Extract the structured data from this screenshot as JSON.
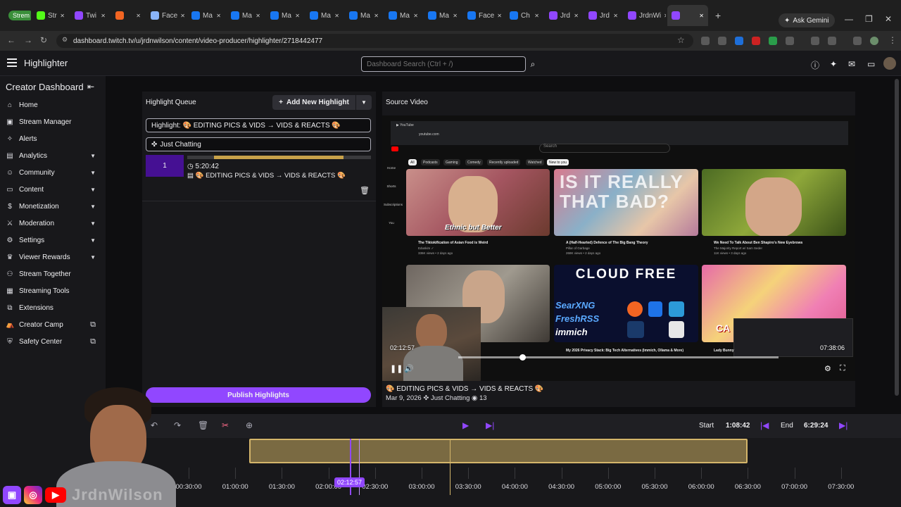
{
  "browser": {
    "tabs": [
      {
        "label": "Strem",
        "color": "#3a8f3a",
        "pill": true
      },
      {
        "label": "Str",
        "color": "#53fc18"
      },
      {
        "label": "Twi",
        "color": "#9147ff"
      },
      {
        "label": "",
        "color": "#f26522"
      },
      {
        "label": "Face",
        "color": "#8ab4f8"
      },
      {
        "label": "Ma",
        "color": "#1877f2"
      },
      {
        "label": "Ma",
        "color": "#1877f2"
      },
      {
        "label": "Ma",
        "color": "#1877f2"
      },
      {
        "label": "Ma",
        "color": "#1877f2"
      },
      {
        "label": "Ma",
        "color": "#1877f2"
      },
      {
        "label": "Ma",
        "color": "#1877f2"
      },
      {
        "label": "Ma",
        "color": "#1877f2"
      },
      {
        "label": "Face",
        "color": "#1877f2"
      },
      {
        "label": "Ch",
        "color": "#1877f2"
      },
      {
        "label": "Jrd",
        "color": "#9147ff"
      },
      {
        "label": "Jrd",
        "color": "#9147ff"
      },
      {
        "label": "JrdnWi",
        "color": "#9147ff"
      },
      {
        "label": "",
        "color": "#9147ff",
        "active": true
      }
    ],
    "ask_gemini": "Ask Gemini",
    "url": "dashboard.twitch.tv/u/jrdnwilson/content/video-producer/highlighter/2718442477"
  },
  "header": {
    "title": "Highlighter",
    "search_placeholder": "Dashboard Search (Ctrl + /)"
  },
  "sidebar": {
    "title": "Creator Dashboard",
    "items": [
      {
        "label": "Home",
        "icon": "home-icon",
        "glyph": "⌂",
        "chevron": false,
        "external": false
      },
      {
        "label": "Stream Manager",
        "icon": "stream-manager-icon",
        "glyph": "▣",
        "chevron": false,
        "external": false
      },
      {
        "label": "Alerts",
        "icon": "alerts-icon",
        "glyph": "✧",
        "chevron": false,
        "external": false
      },
      {
        "label": "Analytics",
        "icon": "analytics-icon",
        "glyph": "▤",
        "chevron": true,
        "external": false
      },
      {
        "label": "Community",
        "icon": "community-icon",
        "glyph": "☺",
        "chevron": true,
        "external": false
      },
      {
        "label": "Content",
        "icon": "content-icon",
        "glyph": "▭",
        "chevron": true,
        "external": false
      },
      {
        "label": "Monetization",
        "icon": "monetization-icon",
        "glyph": "$",
        "chevron": true,
        "external": false
      },
      {
        "label": "Moderation",
        "icon": "moderation-icon",
        "glyph": "⚔",
        "chevron": true,
        "external": false
      },
      {
        "label": "Settings",
        "icon": "settings-icon",
        "glyph": "⚙",
        "chevron": true,
        "external": false
      },
      {
        "label": "Viewer Rewards",
        "icon": "viewer-rewards-icon",
        "glyph": "♛",
        "chevron": true,
        "external": false
      },
      {
        "label": "Stream Together",
        "icon": "stream-together-icon",
        "glyph": "⚇",
        "chevron": false,
        "external": false
      },
      {
        "label": "Streaming Tools",
        "icon": "streaming-tools-icon",
        "glyph": "▦",
        "chevron": false,
        "external": false
      },
      {
        "label": "Extensions",
        "icon": "extensions-icon",
        "glyph": "⧉",
        "chevron": false,
        "external": false
      },
      {
        "label": "Creator Camp",
        "icon": "creator-camp-icon",
        "glyph": "⛺",
        "chevron": false,
        "external": true
      },
      {
        "label": "Safety Center",
        "icon": "safety-center-icon",
        "glyph": "⛨",
        "chevron": false,
        "external": true
      }
    ]
  },
  "queue": {
    "title": "Highlight Queue",
    "add_label": "Add New Highlight",
    "title_field": "Highlight: 🎨 EDITING PICS & VIDS → VIDS & REACTS 🎨",
    "category_field": "Just Chatting",
    "item": {
      "number": "1",
      "duration": "5:20:42",
      "title": "🎨 EDITING PICS & VIDS → VIDS & REACTS 🎨"
    },
    "publish_label": "Publish Highlights"
  },
  "source": {
    "title": "Source Video",
    "current_time": "02:12:57",
    "total_time": "07:38:06",
    "progress": 0.19,
    "video_title": "🎨 EDITING PICS & VIDS → VIDS & REACTS 🎨",
    "date": "Mar 9, 2026",
    "category": "Just Chatting",
    "views": "13"
  },
  "youtube": {
    "chips": [
      "All",
      "Podcasts",
      "Gaming",
      "Comedy",
      "Recently uploaded",
      "Watched",
      "New to you"
    ],
    "sidebar": [
      "Home",
      "Shorts",
      "Subscriptions",
      "You"
    ],
    "search_placeholder": "Search",
    "videos": [
      {
        "title": "The Tiktokification of Asian Food is Weird",
        "meta": "Eduskim ✓",
        "views": "336K views • 2 days ago",
        "caption": "Ethnic but Better"
      },
      {
        "title": "A (Half-Hearted) Defence of The Big Bang Theory",
        "meta": "Pillar of Garbage",
        "views": "268K views • 2 days ago",
        "caption": "IS IT REALLY THAT BAD?"
      },
      {
        "title": "We Need To Talk About Ben Shapiro's New Eyebrows",
        "meta": "The Majority Report w/ Sam Seder",
        "views": "11K views • 3 days ago",
        "caption": ""
      },
      {
        "title": "",
        "meta": "",
        "views": "",
        "caption": ""
      },
      {
        "title": "My 2026 Privacy Stack: Big Tech Alternatives (Immich, Ollama & More)",
        "meta": "",
        "views": "",
        "caption": "CLOUD FREE"
      },
      {
        "title": "Lady Bunny",
        "meta": "",
        "views": "",
        "caption": "CA"
      }
    ],
    "cloud_free_lines": [
      "SearXNG",
      "FreshRSS",
      "immich"
    ]
  },
  "timeline": {
    "start_label": "Start",
    "start_value": "1:08:42",
    "end_label": "End",
    "end_value": "6:29:24",
    "cursor_time": "02:12:57",
    "ticks": [
      "00:30:00",
      "01:00:00",
      "01:30:00",
      "02:00:00",
      "02:30:00",
      "03:00:00",
      "03:30:00",
      "04:00:00",
      "04:30:00",
      "05:00:00",
      "05:30:00",
      "06:00:00",
      "06:30:00",
      "07:00:00",
      "07:30:00"
    ]
  },
  "overlay": {
    "handle": "JrdnWilson"
  }
}
